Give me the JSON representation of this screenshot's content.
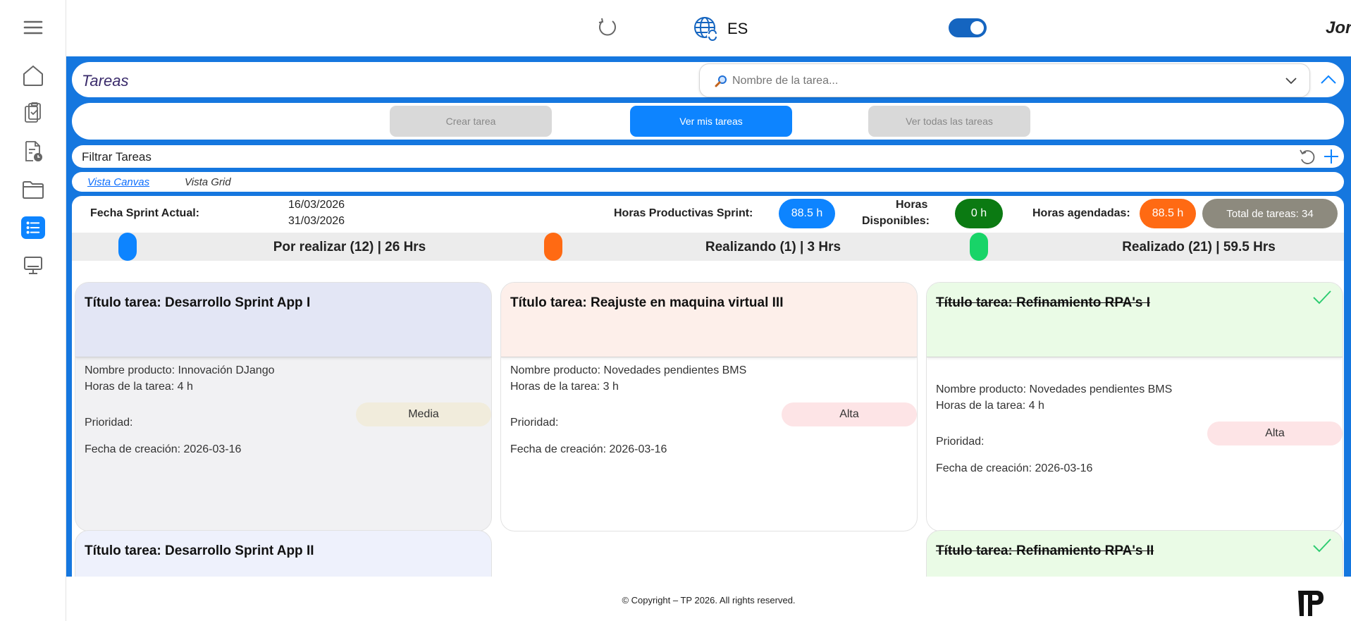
{
  "header": {
    "language": "ES",
    "user_name": "Jorge",
    "toggle_on": true
  },
  "page": {
    "title": "Tareas",
    "search_placeholder": "Nombre de la tarea..."
  },
  "actions": {
    "create": "Crear tarea",
    "mine": "Ver mis tareas",
    "all": "Ver todas las tareas"
  },
  "filter": {
    "label": "Filtrar Tareas"
  },
  "views": {
    "canvas": "Vista Canvas",
    "grid": "Vista Grid"
  },
  "sprint": {
    "date_label": "Fecha Sprint Actual:",
    "start": "16/03/2026",
    "end": "31/03/2026",
    "productive_label": "Horas Productivas Sprint:",
    "productive_value": "88.5 h",
    "available_label_1": "Horas",
    "available_label_2": "Disponibles:",
    "available_value": "0 h",
    "scheduled_label": "Horas agendadas:",
    "scheduled_value": "88.5 h",
    "total": "Total de tareas: 34"
  },
  "columns": [
    {
      "title": "Por realizar (12) | 26 Hrs",
      "color": "#0d84ff"
    },
    {
      "title": "Realizando (1) | 3 Hrs",
      "color": "#ff6a13"
    },
    {
      "title": "Realizado (21) | 59.5 Hrs",
      "color": "#18d468"
    }
  ],
  "cards": [
    {
      "title": "Título tarea: Desarrollo Sprint App I",
      "product": "Nombre producto: Innovación DJango",
      "hours": "Horas de la tarea: 4 h",
      "priority_label": "Prioridad:",
      "priority": "Media",
      "created": "Fecha de creación: 2026-03-16",
      "head_color": "#e3e6f5",
      "priority_color": "#f1ecdc"
    },
    {
      "title": "Título tarea: Reajuste en maquina virtual III",
      "product": "Nombre producto: Novedades pendientes BMS",
      "hours": "Horas de la tarea: 3 h",
      "priority_label": "Prioridad:",
      "priority": "Alta",
      "created": "Fecha de creación: 2026-03-16",
      "head_color": "#fdefea",
      "priority_color": "#fde4e6"
    },
    {
      "title": "Título tarea: Refinamiento RPA's I",
      "product": "Nombre producto: Novedades pendientes BMS",
      "hours": "Horas de la tarea: 4 h",
      "priority_label": "Prioridad:",
      "priority": "Alta",
      "created": "Fecha de creación: 2026-03-16",
      "head_color": "#eafbe6",
      "priority_color": "#fde4e6"
    }
  ],
  "cards_row2": [
    {
      "title": "Título tarea: Desarrollo Sprint App II",
      "head_color": "#eef1fc"
    },
    {
      "title": "Título tarea: Refinamiento RPA's II",
      "head_color": "#eafbe6"
    }
  ],
  "footer": {
    "copyright": "© Copyright – TP 2026. All rights reserved."
  }
}
